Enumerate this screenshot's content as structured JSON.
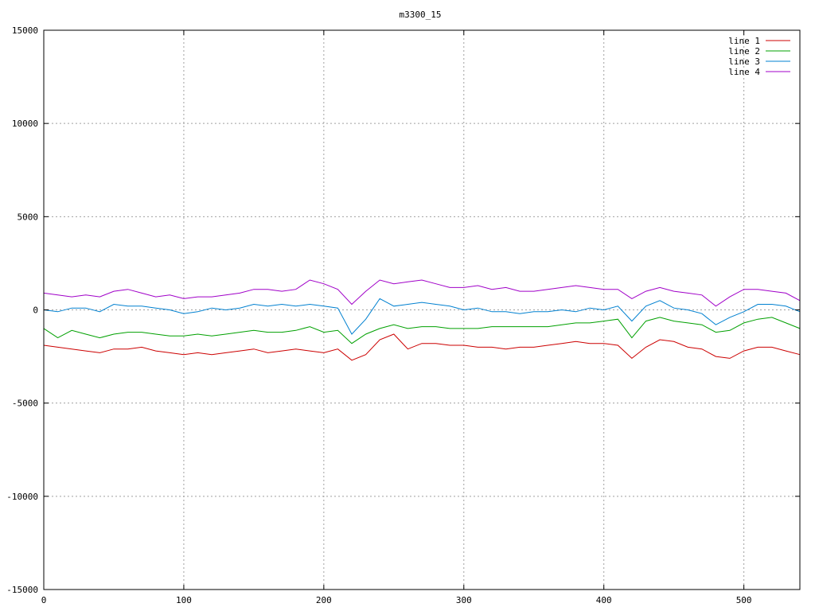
{
  "chart_data": {
    "type": "line",
    "title": "m3300_15",
    "xlabel": "",
    "ylabel": "",
    "xlim": [
      0,
      540
    ],
    "ylim": [
      -15000,
      15000
    ],
    "x_ticks": [
      0,
      100,
      200,
      300,
      400,
      500
    ],
    "y_ticks": [
      -15000,
      -10000,
      -5000,
      0,
      5000,
      10000,
      15000
    ],
    "grid": true,
    "legend_position": "top-right",
    "x": [
      0,
      10,
      20,
      30,
      40,
      50,
      60,
      70,
      80,
      90,
      100,
      110,
      120,
      130,
      140,
      150,
      160,
      170,
      180,
      190,
      200,
      210,
      220,
      230,
      240,
      250,
      260,
      270,
      280,
      290,
      300,
      310,
      320,
      330,
      340,
      350,
      360,
      370,
      380,
      390,
      400,
      410,
      420,
      430,
      440,
      450,
      460,
      470,
      480,
      490,
      500,
      510,
      520,
      530,
      540
    ],
    "series": [
      {
        "name": "line 1",
        "color": "#cc0000",
        "values": [
          -1900,
          -2000,
          -2100,
          -2200,
          -2300,
          -2100,
          -2100,
          -2000,
          -2200,
          -2300,
          -2400,
          -2300,
          -2400,
          -2300,
          -2200,
          -2100,
          -2300,
          -2200,
          -2100,
          -2200,
          -2300,
          -2100,
          -2700,
          -2400,
          -1600,
          -1300,
          -2100,
          -1800,
          -1800,
          -1900,
          -1900,
          -2000,
          -2000,
          -2100,
          -2000,
          -2000,
          -1900,
          -1800,
          -1700,
          -1800,
          -1800,
          -1900,
          -2600,
          -2000,
          -1600,
          -1700,
          -2000,
          -2100,
          -2500,
          -2600,
          -2200,
          -2000,
          -2000,
          -2200,
          -2400
        ]
      },
      {
        "name": "line 2",
        "color": "#00a000",
        "values": [
          -1000,
          -1500,
          -1100,
          -1300,
          -1500,
          -1300,
          -1200,
          -1200,
          -1300,
          -1400,
          -1400,
          -1300,
          -1400,
          -1300,
          -1200,
          -1100,
          -1200,
          -1200,
          -1100,
          -900,
          -1200,
          -1100,
          -1800,
          -1300,
          -1000,
          -800,
          -1000,
          -900,
          -900,
          -1000,
          -1000,
          -1000,
          -900,
          -900,
          -900,
          -900,
          -900,
          -800,
          -700,
          -700,
          -600,
          -500,
          -1500,
          -600,
          -400,
          -600,
          -700,
          -800,
          -1200,
          -1100,
          -700,
          -500,
          -400,
          -700,
          -1000
        ]
      },
      {
        "name": "line 3",
        "color": "#0080d0",
        "values": [
          0,
          -100,
          100,
          100,
          -100,
          300,
          200,
          200,
          100,
          0,
          -200,
          -100,
          100,
          0,
          100,
          300,
          200,
          300,
          200,
          300,
          200,
          100,
          -1300,
          -500,
          600,
          200,
          300,
          400,
          300,
          200,
          0,
          100,
          -100,
          -100,
          -200,
          -100,
          -100,
          0,
          -100,
          100,
          0,
          200,
          -600,
          200,
          500,
          100,
          0,
          -200,
          -800,
          -400,
          -100,
          300,
          300,
          200,
          -100
        ]
      },
      {
        "name": "line 4",
        "color": "#a000c8",
        "values": [
          900,
          800,
          700,
          800,
          700,
          1000,
          1100,
          900,
          700,
          800,
          600,
          700,
          700,
          800,
          900,
          1100,
          1100,
          1000,
          1100,
          1600,
          1400,
          1100,
          300,
          1000,
          1600,
          1400,
          1500,
          1600,
          1400,
          1200,
          1200,
          1300,
          1100,
          1200,
          1000,
          1000,
          1100,
          1200,
          1300,
          1200,
          1100,
          1100,
          600,
          1000,
          1200,
          1000,
          900,
          800,
          200,
          700,
          1100,
          1100,
          1000,
          900,
          500
        ]
      }
    ]
  }
}
